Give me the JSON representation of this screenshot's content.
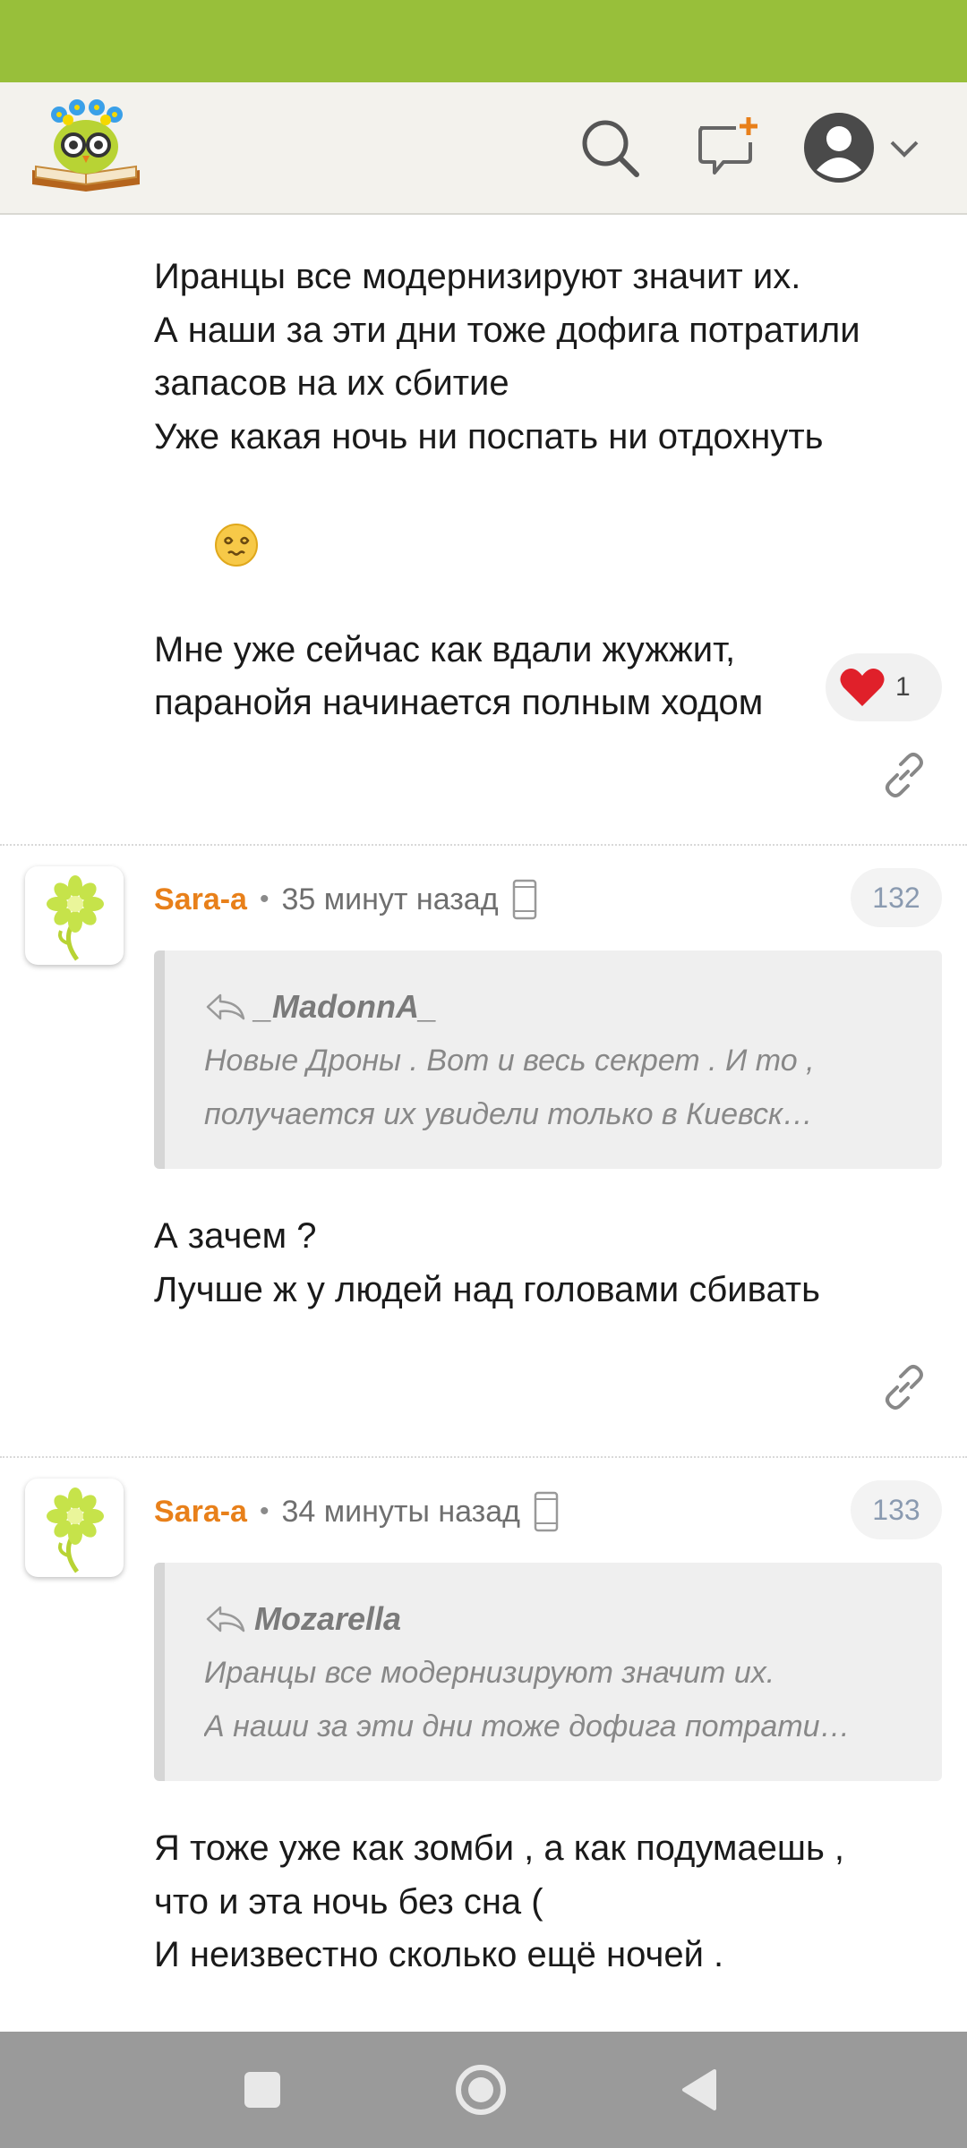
{
  "colors": {
    "status_bar": "#98bf3a",
    "header_bg": "#f3f2ed",
    "author": "#e8801a",
    "nav_bar": "#9a9a9a"
  },
  "header": {
    "logo_icon": "owl-book-logo",
    "search_icon": "search-icon",
    "new_post_icon": "new-message-icon",
    "profile_icon": "user-avatar-icon"
  },
  "top_comment": {
    "lines": [
      "Иранцы все модернизируют значит их.",
      "А наши за эти дни тоже дофига потратили",
      "запасов на их сбитие",
      "Уже какая ночь ни поспать ни отдохнуть"
    ],
    "emoji": "dizzy-face-emoji",
    "lines_after": [
      "Мне уже сейчас как вдали жужжит,",
      "паранойя начинается полным ходом"
    ],
    "reaction": {
      "icon": "heart-icon",
      "count": "1"
    }
  },
  "comments": [
    {
      "author": "Sara-a",
      "time": "35 минут назад",
      "number": "132",
      "quote": {
        "author": "_MadonnA_",
        "lines": [
          "Новые Дроны . Вот и весь секрет . И то ,",
          "получается их увидели только в Киевск…"
        ]
      },
      "text": [
        "А зачем ?",
        "Лучше ж у людей над головами сбивать"
      ]
    },
    {
      "author": "Sara-a",
      "time": "34 минуты назад",
      "number": "133",
      "quote": {
        "author": "Mozarella",
        "lines": [
          "Иранцы все модернизируют значит их.",
          "А наши за эти дни тоже дофига потрати…"
        ]
      },
      "text": [
        "Я тоже уже как зомби , а как подумаешь ,",
        "что и эта ночь без сна (",
        "И неизвестно сколько ещё ночей ."
      ]
    }
  ]
}
